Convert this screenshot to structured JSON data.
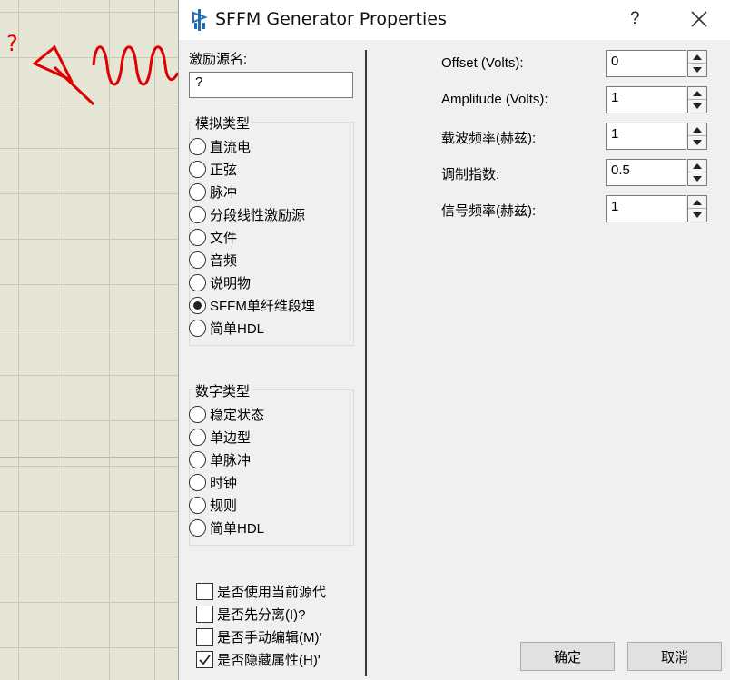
{
  "schematic": {
    "component_label": "?"
  },
  "dialog": {
    "title": "SFFM Generator Properties",
    "help_button": "?",
    "source_name": {
      "label": "激励源名:",
      "value": "?"
    },
    "analog_group": {
      "title": "模拟类型",
      "options": [
        {
          "label": "直流电",
          "checked": false
        },
        {
          "label": "正弦",
          "checked": false
        },
        {
          "label": "脉冲",
          "checked": false
        },
        {
          "label": "分段线性激励源",
          "checked": false
        },
        {
          "label": "文件",
          "checked": false
        },
        {
          "label": "音频",
          "checked": false
        },
        {
          "label": "说明物",
          "checked": false
        },
        {
          "label": "SFFM单纤维段埋",
          "checked": true
        },
        {
          "label": "简单HDL",
          "checked": false
        }
      ]
    },
    "digital_group": {
      "title": "数字类型",
      "options": [
        {
          "label": "稳定状态",
          "checked": false
        },
        {
          "label": "单边型",
          "checked": false
        },
        {
          "label": "单脉冲",
          "checked": false
        },
        {
          "label": "时钟",
          "checked": false
        },
        {
          "label": "规则",
          "checked": false
        },
        {
          "label": "简单HDL",
          "checked": false
        }
      ]
    },
    "checkboxes": [
      {
        "label": "是否使用当前源代",
        "checked": false
      },
      {
        "label": "是否先分离(I)?",
        "checked": false
      },
      {
        "label": "是否手动编辑(M)'",
        "checked": false
      },
      {
        "label": "是否隐藏属性(H)'",
        "checked": true
      }
    ],
    "parameters": [
      {
        "label": "Offset (Volts):",
        "value": "0"
      },
      {
        "label": "Amplitude (Volts):",
        "value": "1"
      },
      {
        "label": "载波频率(赫兹):",
        "value": "1"
      },
      {
        "label": "调制指数:",
        "value": "0.5"
      },
      {
        "label": "信号频率(赫兹):",
        "value": "1"
      }
    ],
    "ok_button": "确定",
    "cancel_button": "取消"
  },
  "colors": {
    "schematic_bg": "#e6e6d6",
    "component_red": "#e00000",
    "dialog_bg": "#f0f0f0",
    "title_icon_blue": "#1f6fb5"
  }
}
